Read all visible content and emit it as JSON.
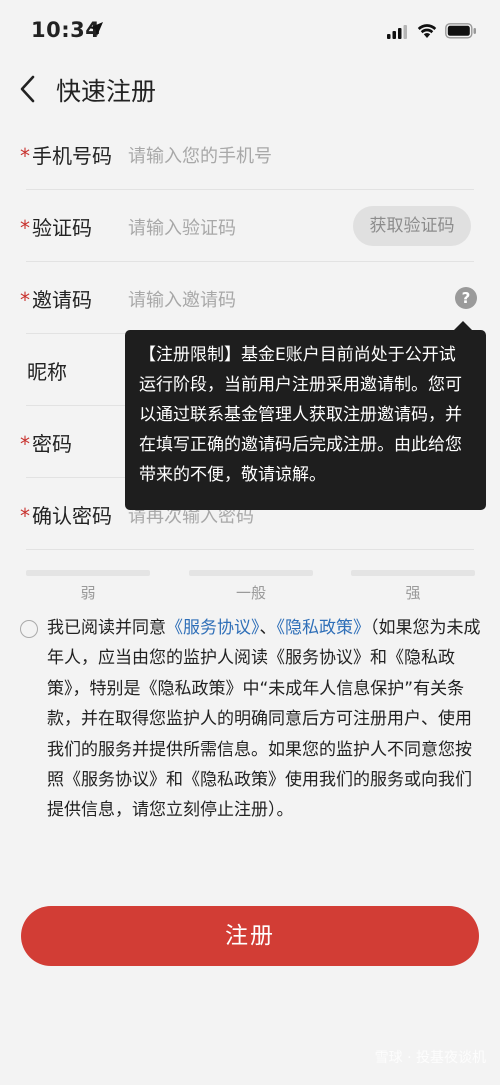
{
  "status": {
    "time": "10:34"
  },
  "nav": {
    "title": "快速注册"
  },
  "form": {
    "phone": {
      "label": "手机号码",
      "placeholder": "请输入您的手机号"
    },
    "code": {
      "label": "验证码",
      "placeholder": "请输入验证码",
      "button": "获取验证码"
    },
    "invite": {
      "label": "邀请码",
      "placeholder": "请输入邀请码",
      "help": "?"
    },
    "nickname": {
      "label": "昵称"
    },
    "password": {
      "label": "密码"
    },
    "confirm": {
      "label": "确认密码",
      "placeholder": "请再次输入密码"
    },
    "required_mark": "*"
  },
  "tooltip": "【注册限制】基金E账户目前尚处于公开试运行阶段，当前用户注册采用邀请制。您可以通过联系基金管理人获取注册邀请码，并在填写正确的邀请码后完成注册。由此给您带来的不便，敬请谅解。",
  "strength": {
    "weak": "弱",
    "medium": "一般",
    "strong": "强"
  },
  "agreement": {
    "prefix": "我已阅读并同意",
    "service_link": "《服务协议》",
    "sep": "、",
    "privacy_link": "《隐私政策》",
    "body": "（如果您为未成年人，应当由您的监护人阅读《服务协议》和《隐私政策》，特别是《隐私政策》中“未成年人信息保护”有关条款，并在取得您监护人的明确同意后方可注册用户、使用我们的服务并提供所需信息。如果您的监护人不同意您按照《服务协议》和《隐私政策》使用我们的服务或向我们提供信息，请您立刻停止注册）。"
  },
  "register_button": "注册",
  "watermark": "雪球 · 投基夜谈机",
  "colors": {
    "accent": "#d23d35",
    "link": "#2f6fb8",
    "required": "#c8322e"
  }
}
